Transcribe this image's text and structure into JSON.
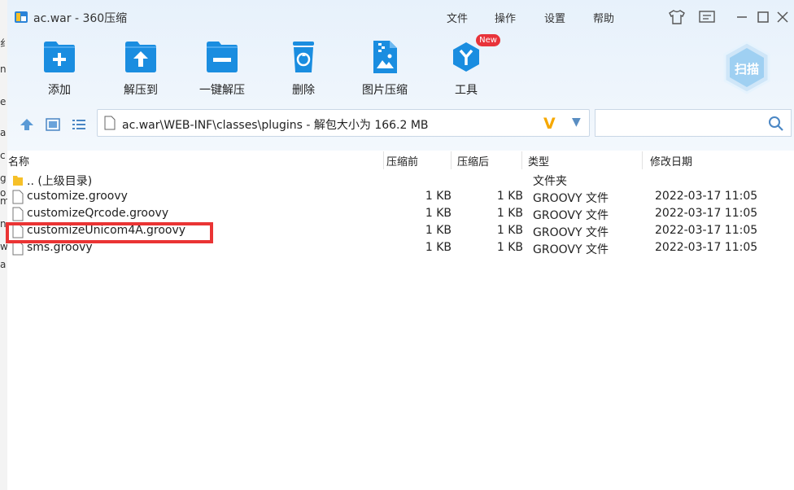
{
  "left_strip": {
    "fragments": [
      "纟",
      "n",
      "e",
      "a",
      "c",
      "g",
      "o",
      "m",
      "n",
      "w",
      "a"
    ]
  },
  "title_bar": {
    "title": "ac.war - 360压缩",
    "menu": [
      "文件",
      "操作",
      "设置",
      "帮助"
    ]
  },
  "toolbar": {
    "items": [
      {
        "label": "添加",
        "icon": "add-folder-icon"
      },
      {
        "label": "解压到",
        "icon": "extract-to-icon"
      },
      {
        "label": "一键解压",
        "icon": "one-click-extract-icon"
      },
      {
        "label": "删除",
        "icon": "delete-bin-icon"
      },
      {
        "label": "图片压缩",
        "icon": "image-compress-icon"
      },
      {
        "label": "工具",
        "icon": "tools-icon"
      }
    ],
    "new_badge": "New",
    "scan_label": "扫描"
  },
  "address": {
    "path": "ac.war\\WEB-INF\\classes\\plugins - 解包大小为 166.2 MB",
    "search_placeholder": ""
  },
  "columns": {
    "name": "名称",
    "before": "压缩前",
    "after": "压缩后",
    "type": "类型",
    "date": "修改日期"
  },
  "files": [
    {
      "name": ".. (上级目录)",
      "before": "",
      "after": "",
      "type": "文件夹",
      "date": "",
      "kind": "folder"
    },
    {
      "name": "customize.groovy",
      "before": "1 KB",
      "after": "1 KB",
      "type": "GROOVY 文件",
      "date": "2022-03-17 11:05",
      "kind": "file"
    },
    {
      "name": "customizeQrcode.groovy",
      "before": "1 KB",
      "after": "1 KB",
      "type": "GROOVY 文件",
      "date": "2022-03-17 11:05",
      "kind": "file"
    },
    {
      "name": "customizeUnicom4A.groovy",
      "before": "1 KB",
      "after": "1 KB",
      "type": "GROOVY 文件",
      "date": "2022-03-17 11:05",
      "kind": "file"
    },
    {
      "name": "sms.groovy",
      "before": "1 KB",
      "after": "1 KB",
      "type": "GROOVY 文件",
      "date": "2022-03-17 11:05",
      "kind": "file"
    }
  ],
  "colors": {
    "accent": "#1a8de0",
    "highlight_border": "#ea3434",
    "badge": "#e8333a"
  }
}
